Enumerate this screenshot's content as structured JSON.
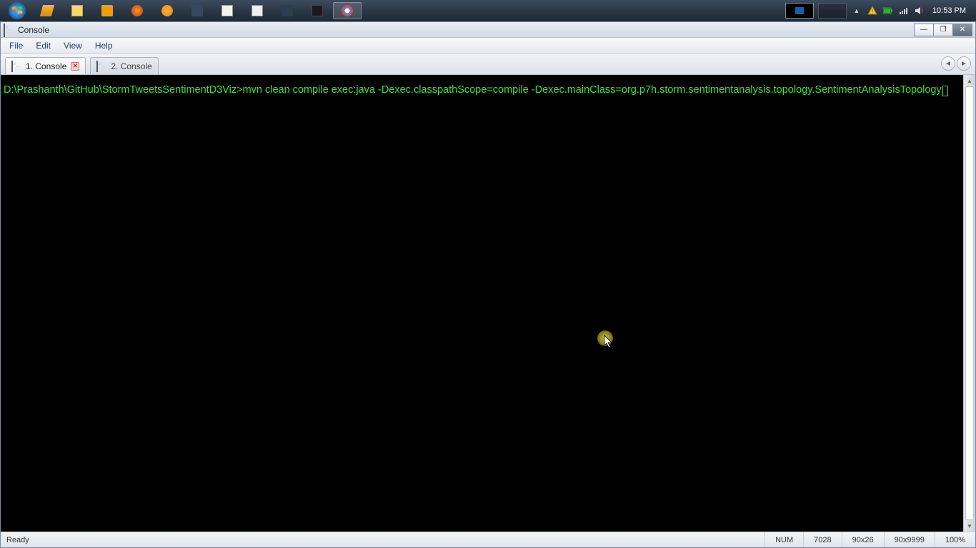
{
  "taskbar": {
    "clock": "10:53 PM",
    "tray_icons": [
      "chevron-up",
      "shield-warning",
      "battery",
      "network",
      "volume"
    ]
  },
  "window": {
    "title": "Console",
    "menus": [
      "File",
      "Edit",
      "View",
      "Help"
    ],
    "tabs": [
      {
        "label": "1. Console",
        "active": true,
        "closable": true
      },
      {
        "label": "2. Console",
        "active": false,
        "closable": false
      }
    ],
    "terminal": {
      "prompt": "D:\\Prashanth\\GitHub\\StormTweetsSentimentD3Viz>",
      "command": "mvn clean compile exec:java -Dexec.classpathScope=compile -Dexec.mainClass=org.p7h.storm.sentimentanalysis.topology.SentimentAnalysisTopology",
      "text_color": "#3ee03e"
    },
    "status": {
      "left": "Ready",
      "numlock": "NUM",
      "pid": "7028",
      "dims": "90x26",
      "buffer": "90x9999",
      "zoom": "100%"
    }
  }
}
